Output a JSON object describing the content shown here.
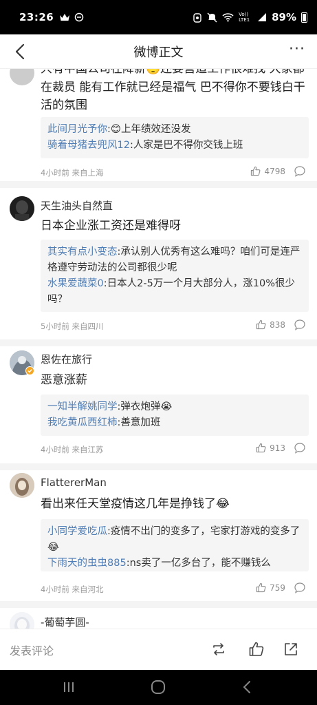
{
  "status": {
    "time": "23:26",
    "left_icons": [
      "crown-icon",
      "minus-circle-icon"
    ],
    "right_icons": [
      "alarm-icon",
      "mute-icon",
      "wifi-icon",
      "volte-icon",
      "signal-icon"
    ],
    "volte": "Vo)) LTE1",
    "battery": "89%"
  },
  "nav": {
    "title": "微博正文",
    "more": "···"
  },
  "comments": [
    {
      "text": "只有中国公司在降薪🙄还要营造工作很难找 大家都在裁员 能有工作就已经是福气 巴不得你不要钱白干活的氛围",
      "replies": [
        {
          "name": "此间月光予你",
          "text": ":😊上年绩效还没发"
        },
        {
          "name": "骑着母猪去兜风12",
          "text": ":人家是巴不得你交钱上班"
        }
      ],
      "meta": "4小时前 来自上海",
      "likes": "4798"
    },
    {
      "username": "天生油头自然直",
      "text": "日本企业涨工资还是难得呀",
      "replies": [
        {
          "name": "其实有点小变态",
          "text": ":承认别人优秀有这么难吗？咱们可是连严格遵守劳动法的公司都很少呢"
        },
        {
          "name": "水果爱蔬菜0",
          "text": ":日本人2-5万一个月大部分人，涨10%很少吗？"
        }
      ],
      "meta": "5小时前 来自四川",
      "likes": "838"
    },
    {
      "username": "恩佐在旅行",
      "text": "恶意涨薪",
      "replies": [
        {
          "name": "一知半解姚同学",
          "text": ":弹衣炮弹😭"
        },
        {
          "name": "我吃黄瓜西红柿",
          "text": ":善意加班"
        }
      ],
      "meta": "4小时前 来自江苏",
      "likes": "913"
    },
    {
      "username": "FlattererMan",
      "text": "看出来任天堂疫情这几年是挣钱了😂",
      "replies": [
        {
          "name": "小同学爱吃瓜",
          "text": ":疫情不出门的变多了，宅家打游戏的变多了😂"
        },
        {
          "name": "下雨天的虫虫885",
          "text": ":ns卖了一亿多台了，能不赚钱么"
        }
      ],
      "meta": "4小时前 来自河北",
      "likes": "759"
    },
    {
      "username": "-葡萄芋圆-"
    }
  ],
  "bottom": {
    "placeholder": "发表评论"
  },
  "colors": {
    "link": "#4f7db5",
    "meta": "#9a9a9a",
    "reply_bg": "#f5f5f5"
  }
}
